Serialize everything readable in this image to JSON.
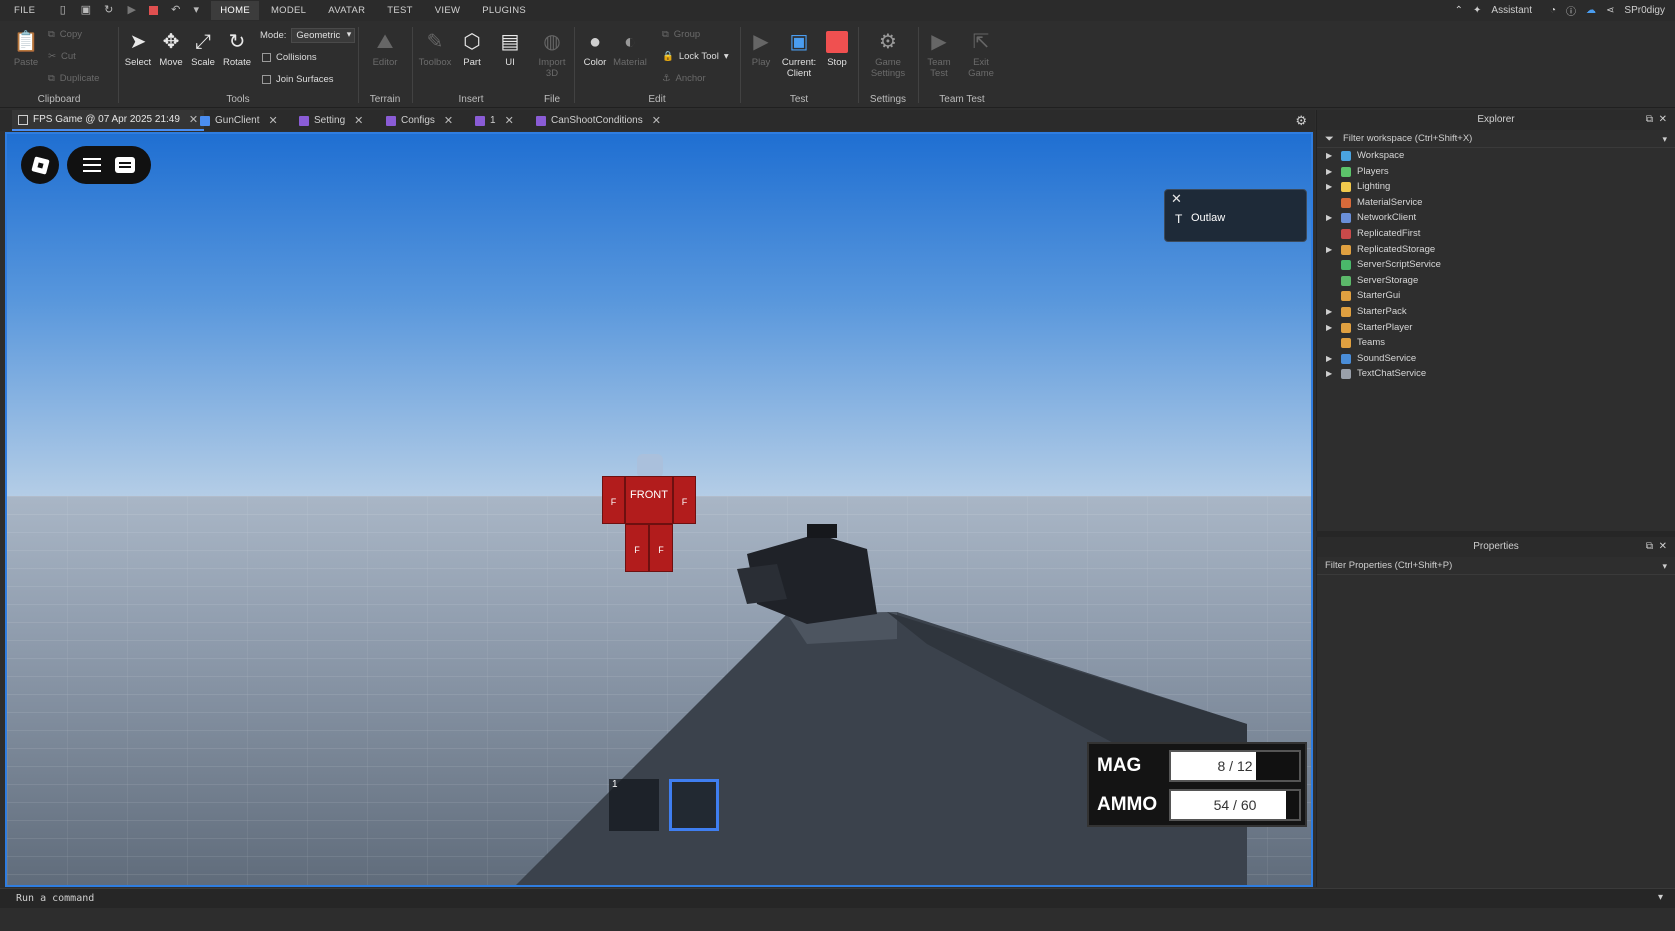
{
  "menubar": {
    "menus": [
      "FILE",
      "HOME",
      "MODEL",
      "AVATAR",
      "TEST",
      "VIEW",
      "PLUGINS"
    ],
    "active": "HOME",
    "assistant_label": "Assistant",
    "user_name": "SPr0digy"
  },
  "ribbon": {
    "clipboard": {
      "paste": "Paste",
      "copy": "Copy",
      "cut": "Cut",
      "duplicate": "Duplicate",
      "label": "Clipboard"
    },
    "tools": {
      "select": "Select",
      "move": "Move",
      "scale": "Scale",
      "rotate": "Rotate",
      "mode_label": "Mode:",
      "mode_value": "Geometric",
      "collisions": "Collisions",
      "join_surfaces": "Join Surfaces",
      "label": "Tools"
    },
    "terrain": {
      "editor": "Editor",
      "label": "Terrain"
    },
    "insert": {
      "toolbox": "Toolbox",
      "part": "Part",
      "ui": "UI",
      "label": "Insert"
    },
    "file": {
      "import3d": "Import 3D",
      "label": "File"
    },
    "edit": {
      "color": "Color",
      "material": "Material",
      "group": "Group",
      "lock_tool": "Lock Tool",
      "anchor": "Anchor",
      "label": "Edit"
    },
    "test": {
      "play": "Play",
      "current_line1": "Current:",
      "current_line2": "Client",
      "stop": "Stop",
      "label": "Test"
    },
    "settings": {
      "game_settings_line1": "Game",
      "game_settings_line2": "Settings",
      "label": "Settings"
    },
    "team_test": {
      "team_test_line1": "Team",
      "team_test_line2": "Test",
      "exit_game_line1": "Exit",
      "exit_game_line2": "Game",
      "label": "Team Test"
    }
  },
  "tabs": [
    {
      "label": "FPS Game @ 07 Apr 2025 21:49",
      "kind": "doc"
    },
    {
      "label": "GunClient",
      "kind": "local"
    },
    {
      "label": "Setting",
      "kind": "script"
    },
    {
      "label": "Configs",
      "kind": "script"
    },
    {
      "label": "1",
      "kind": "script"
    },
    {
      "label": "CanShootConditions",
      "kind": "script"
    }
  ],
  "viewport": {
    "team_label": "Outlaw",
    "npc": {
      "front_label": "FRONT",
      "f_label": "F"
    },
    "hotbar": {
      "slot1_number": "1"
    },
    "hud": {
      "mag_label": "MAG",
      "mag_value": "8 / 12",
      "mag_fraction": 0.6667,
      "ammo_label": "AMMO",
      "ammo_value": "54 / 60",
      "ammo_fraction": 0.9
    }
  },
  "command_bar": {
    "placeholder": "Run a command"
  },
  "explorer": {
    "title": "Explorer",
    "filter_placeholder": "Filter workspace (Ctrl+Shift+X)",
    "items": [
      {
        "label": "Workspace",
        "expandable": true,
        "color": "#4aa3df"
      },
      {
        "label": "Players",
        "expandable": true,
        "color": "#5cc46a"
      },
      {
        "label": "Lighting",
        "expandable": true,
        "color": "#f2c94c"
      },
      {
        "label": "MaterialService",
        "expandable": false,
        "color": "#d86a3a"
      },
      {
        "label": "NetworkClient",
        "expandable": true,
        "color": "#6a8fd8"
      },
      {
        "label": "ReplicatedFirst",
        "expandable": false,
        "color": "#c94a4a"
      },
      {
        "label": "ReplicatedStorage",
        "expandable": true,
        "color": "#e0a040"
      },
      {
        "label": "ServerScriptService",
        "expandable": false,
        "color": "#4ab86a"
      },
      {
        "label": "ServerStorage",
        "expandable": false,
        "color": "#5cb86a"
      },
      {
        "label": "StarterGui",
        "expandable": false,
        "color": "#e0a040"
      },
      {
        "label": "StarterPack",
        "expandable": true,
        "color": "#e0a040"
      },
      {
        "label": "StarterPlayer",
        "expandable": true,
        "color": "#e0a040"
      },
      {
        "label": "Teams",
        "expandable": false,
        "color": "#e0a040"
      },
      {
        "label": "SoundService",
        "expandable": true,
        "color": "#4a8dd8"
      },
      {
        "label": "TextChatService",
        "expandable": true,
        "color": "#9aa0aa"
      }
    ]
  },
  "properties": {
    "title": "Properties",
    "filter_placeholder": "Filter Properties (Ctrl+Shift+P)"
  }
}
